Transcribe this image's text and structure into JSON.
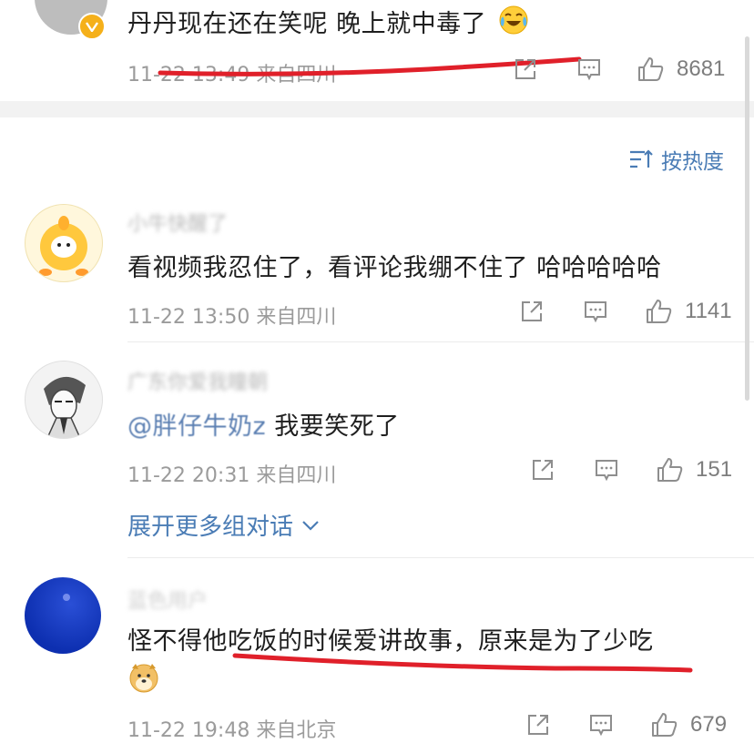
{
  "top_comment": {
    "text": "丹丹现在还在笑呢 晚上就中毒了",
    "meta": "11-22 13:49 来自四川",
    "likes": "8681"
  },
  "sort": {
    "label": "按热度"
  },
  "replies": [
    {
      "user": "小牛快醒了",
      "text": "看视频我忍住了，看评论我绷不住了 哈哈哈哈哈",
      "meta": "11-22 13:50 来自四川",
      "likes": "1141"
    },
    {
      "user": "广东你爱我瞳朝",
      "mention": "@胖仔牛奶z",
      "text": " 我要笑死了",
      "meta": "11-22 20:31 来自四川",
      "likes": "151"
    }
  ],
  "expand_label": "展开更多组对话",
  "last_comment": {
    "user": "蓝色用户",
    "text": "怪不得他吃饭的时候爱讲故事，原来是为了少吃",
    "meta": "11-22 19:48 来自北京",
    "likes": "679"
  },
  "colors": {
    "link": "#4a7cb5",
    "meta": "#9b9b9b",
    "underline": "#e0202a",
    "badge": "#f5b01a"
  },
  "icons": [
    "share-icon",
    "comment-icon",
    "like-icon",
    "sort-icon",
    "chevron-down-icon",
    "laugh-cry-emoji",
    "doge-emoji",
    "verified-badge-icon"
  ]
}
